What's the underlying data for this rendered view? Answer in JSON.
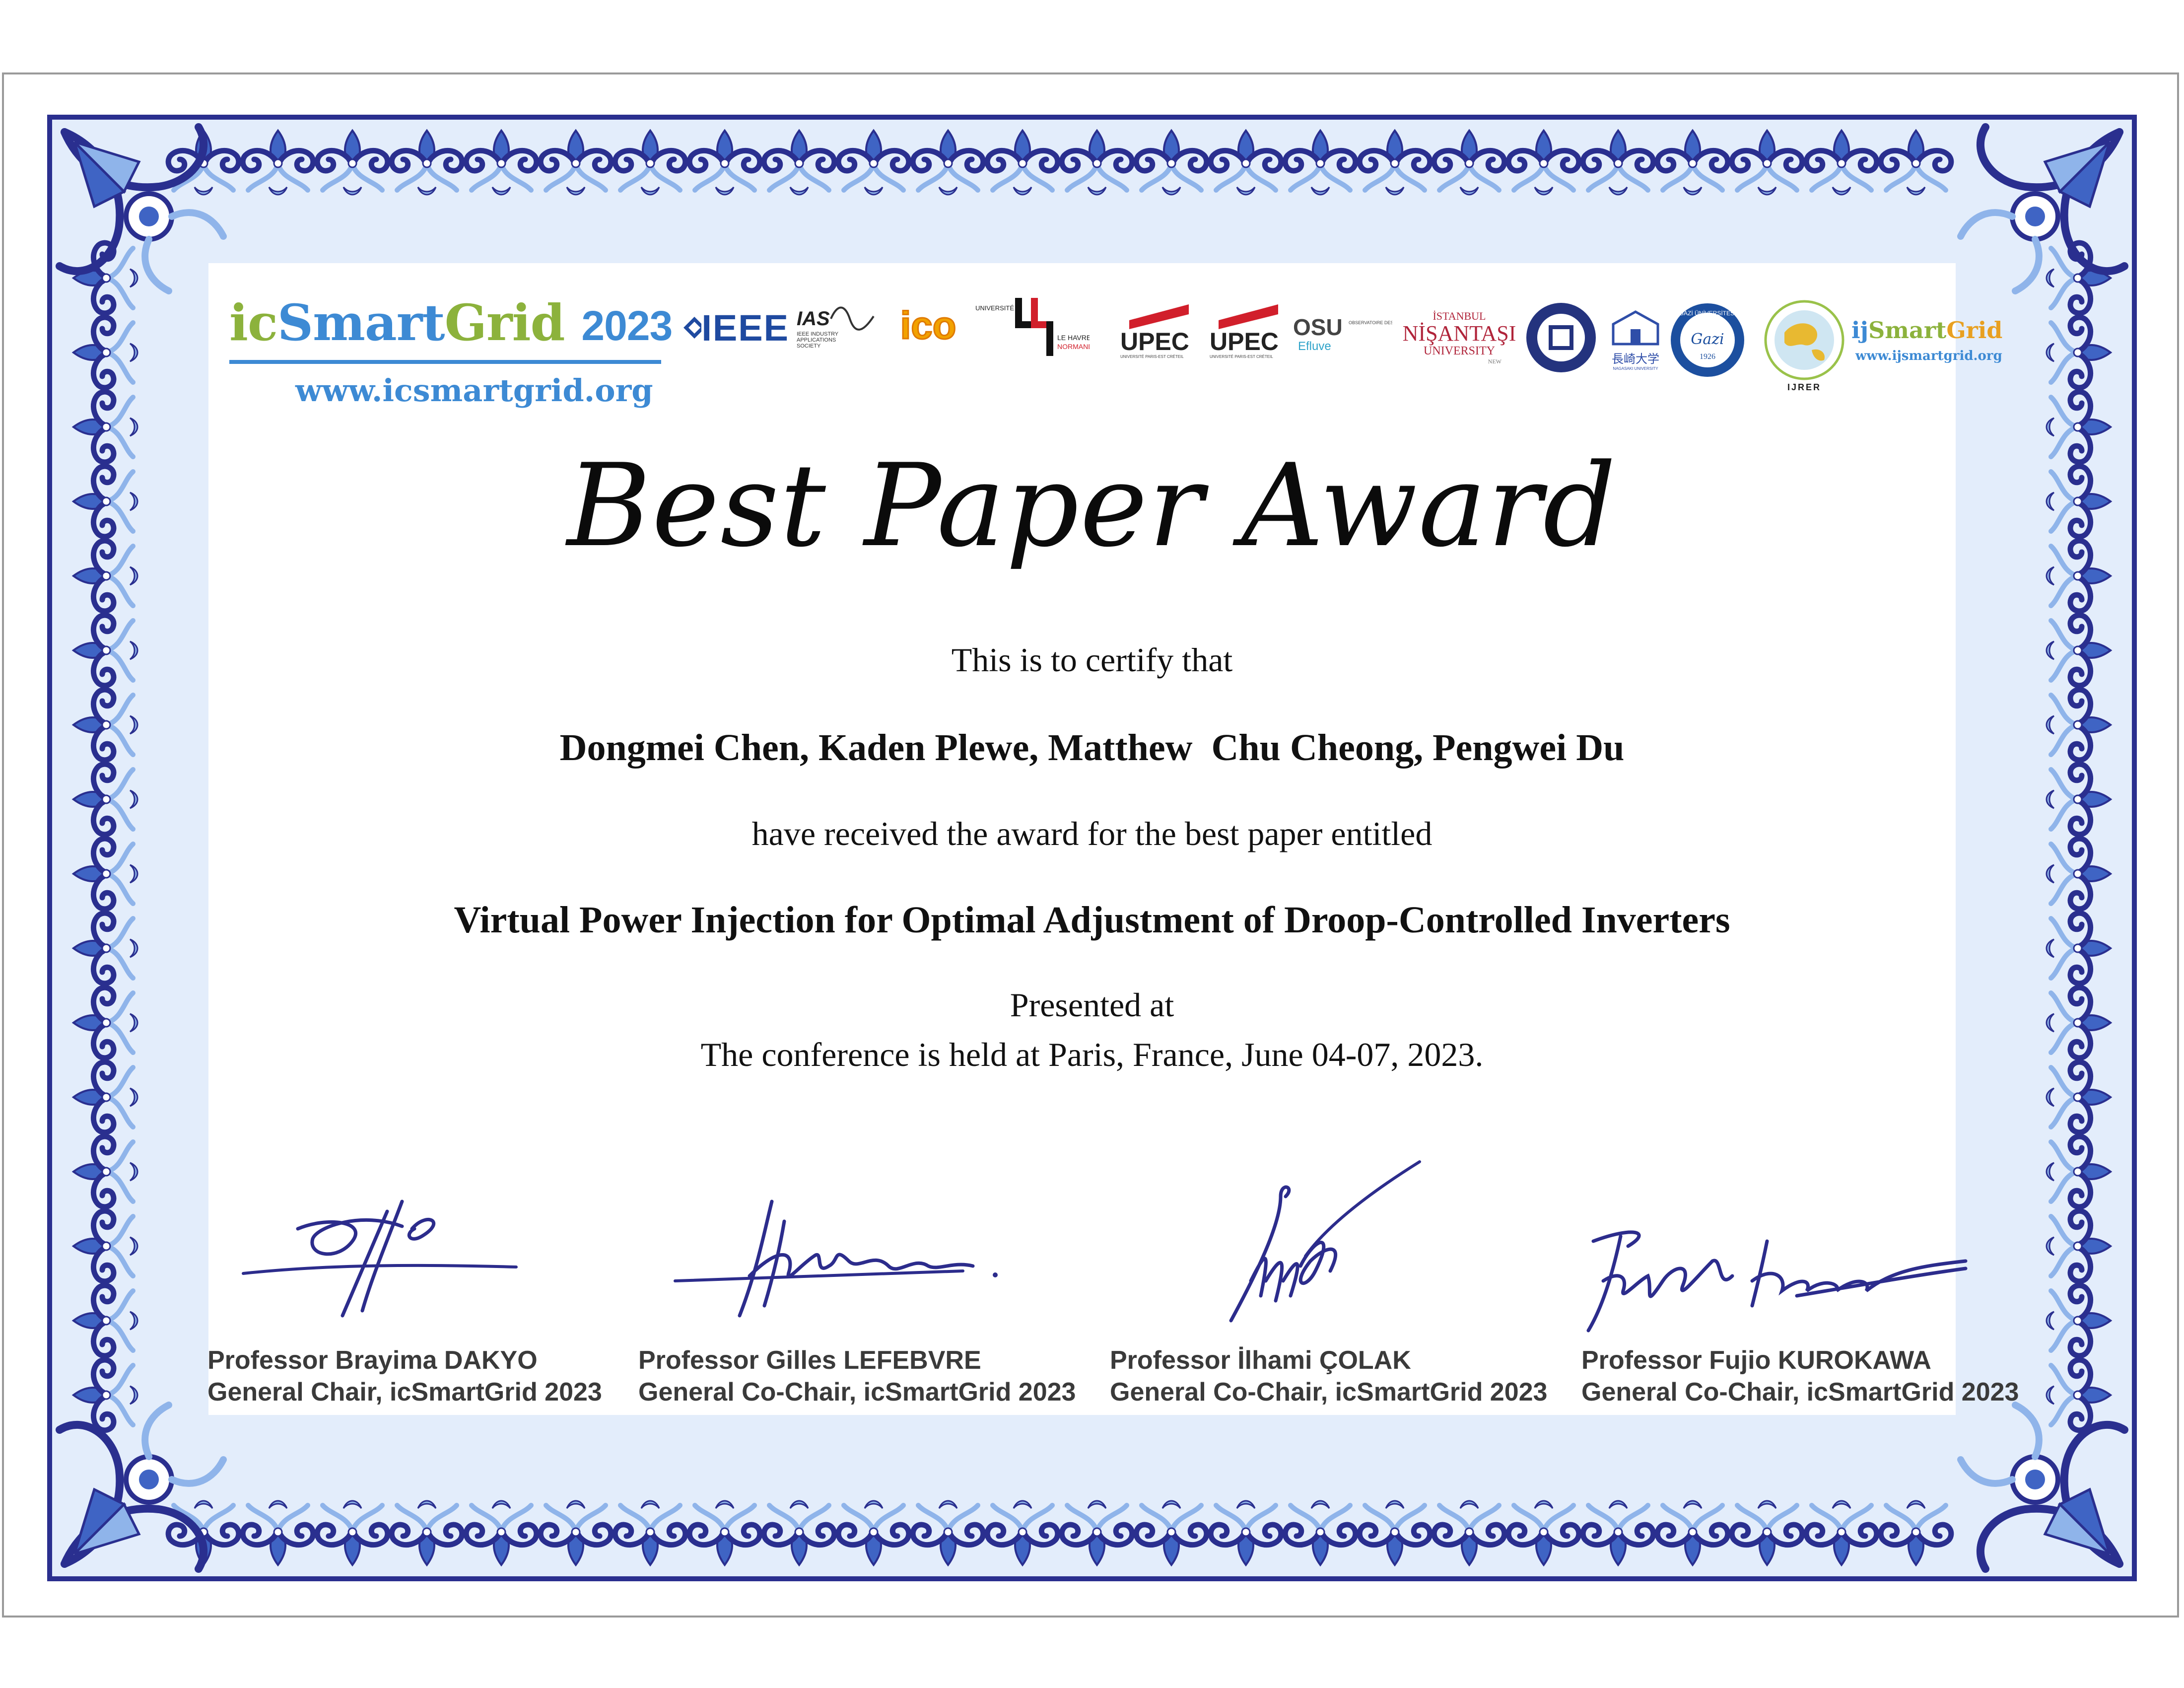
{
  "colors": {
    "border_dark": "#2a2f8f",
    "border_mid": "#3f64c4",
    "border_light": "#8fb4ea",
    "brand_green": "#8cb23c",
    "brand_blue": "#3d8ad4",
    "signature_ink": "#2c2c8c",
    "upec_red": "#d11f2b"
  },
  "header": {
    "brand": {
      "ic": "ic",
      "smart": "Smart",
      "grid": "Grid",
      "year": "2023"
    },
    "website": "www.icsmartgrid.org",
    "logos": {
      "ieee": "IEEE",
      "ias": "IAS",
      "ias_caption": "IEEE INDUSTRY APPLICATIONS SOCIETY",
      "ico": "ico",
      "havre_top": "UNIVERSITÉ",
      "havre_mid": "LE HAVRE",
      "havre_bottom": "NORMANDIE",
      "upec": "UPEC",
      "upec_caption": "UNIVERSITÉ PARIS-EST CRÉTEIL",
      "osu": "OSU",
      "osu_sub": "Efluve",
      "osu_caption": "OBSERVATOIRE DES SCIENCES DE L'UNIVERS",
      "nisantasi_top": "İSTANBUL",
      "nisantasi_main": "NİŞANTAŞI",
      "nisantasi_bottom": "UNIVERSITY",
      "nisantasi_new": "NEW",
      "nagasaki": "長崎大学",
      "nagasaki_caption": "NAGASAKI UNIVERSITY",
      "gazi": "GAZİ ÜNİVERSİTESİ",
      "gazi_year": "1926",
      "ijrer": "IJRER",
      "ijsg_ij": "ij",
      "ijsg_smart": "Smart",
      "ijsg_grid": "Grid",
      "ijsg_url": "www.ijsmartgrid.org"
    }
  },
  "certificate": {
    "title": "Best Paper Award",
    "certify_line": "This is to certify that",
    "authors": "Dongmei Chen, Kaden Plewe, Matthew  Chu Cheong, Pengwei Du",
    "received_line": "have received the award for the best paper entitled",
    "paper_title": "Virtual Power Injection for Optimal Adjustment of Droop-Controlled Inverters",
    "presented_line": "Presented at",
    "conference_line": "The conference is held at Paris, France, June 04-07, 2023."
  },
  "signatories": [
    {
      "name": "Professor Brayima DAKYO",
      "role": "General Chair, icSmartGrid 2023"
    },
    {
      "name": "Professor Gilles LEFEBVRE",
      "role": "General Co-Chair, icSmartGrid 2023"
    },
    {
      "name": "Professor İlhami ÇOLAK",
      "role": "General Co-Chair, icSmartGrid 2023"
    },
    {
      "name": "Professor Fujio KUROKAWA",
      "role": "General Co-Chair, icSmartGrid 2023"
    }
  ]
}
